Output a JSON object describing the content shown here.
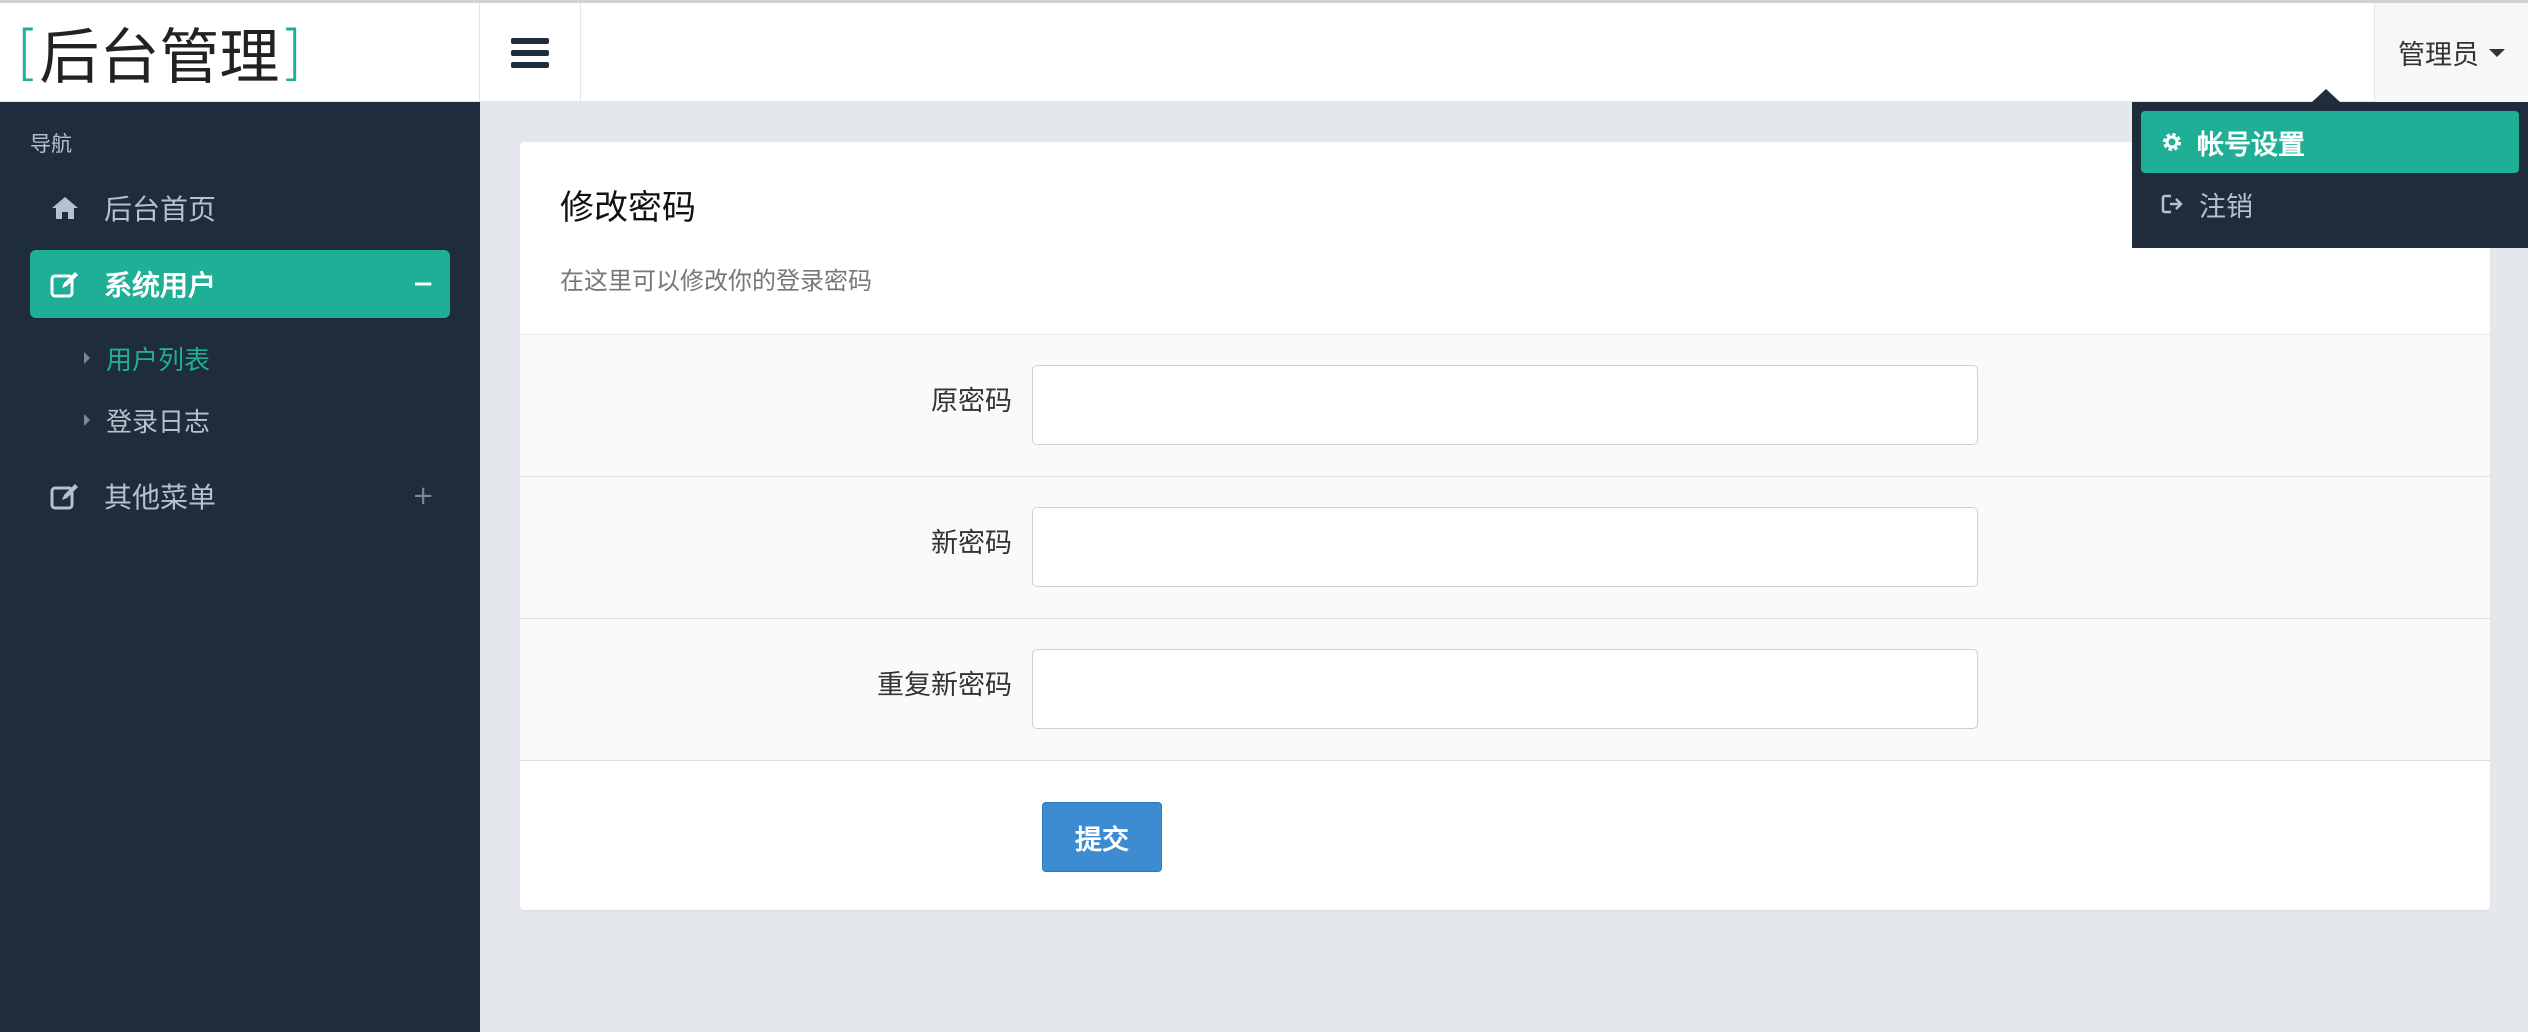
{
  "header": {
    "brand_open": "[",
    "brand_text": "后台管理",
    "brand_close": "]",
    "user_label": "管理员"
  },
  "sidebar": {
    "section_title": "导航",
    "items": [
      {
        "label": "后台首页",
        "icon": "home-icon"
      },
      {
        "label": "系统用户",
        "icon": "edit-icon",
        "toggle": "−",
        "active": true,
        "children": [
          {
            "label": "用户列表",
            "current": true
          },
          {
            "label": "登录日志"
          }
        ]
      },
      {
        "label": "其他菜单",
        "icon": "edit-icon",
        "toggle": "+"
      }
    ]
  },
  "user_dropdown": {
    "items": [
      {
        "label": "帐号设置",
        "icon": "gear-icon",
        "active": true
      },
      {
        "label": "注销",
        "icon": "sign-out-icon"
      }
    ]
  },
  "main": {
    "card_title": "修改密码",
    "card_subtitle": "在这里可以修改你的登录密码",
    "fields": [
      {
        "label": "原密码",
        "value": ""
      },
      {
        "label": "新密码",
        "value": ""
      },
      {
        "label": "重复新密码",
        "value": ""
      }
    ],
    "submit_label": "提交"
  },
  "colors": {
    "accent": "#1fae96",
    "sidebar_bg": "#1f2c3c",
    "primary_button": "#3d8bd0",
    "content_bg": "#e4e8ec"
  }
}
